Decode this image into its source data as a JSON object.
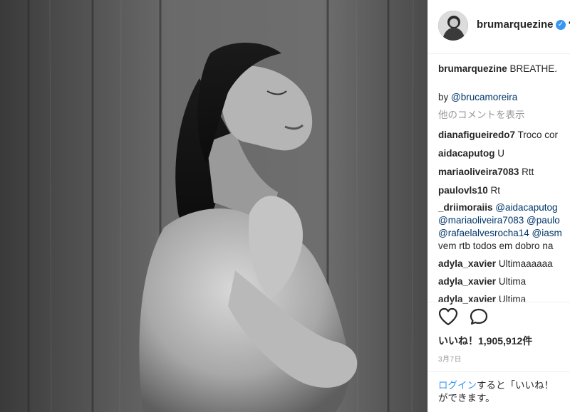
{
  "post": {
    "username": "brumarquezine",
    "more_glyph": "•",
    "caption_user": "brumarquezine",
    "caption_text": " BREATHE.",
    "credit_prefix": "by ",
    "credit_link": "@brucamoreira",
    "view_more": "他のコメントを表示"
  },
  "comments": [
    {
      "user": "dianafigueiredo7",
      "text": " Troco cor"
    },
    {
      "user": "aidacaputog",
      "text": " U"
    },
    {
      "user": "mariaoliveira7083",
      "text": " Rtt"
    },
    {
      "user": "paulovls10",
      "text": " Rt"
    },
    {
      "user": "_driimoraiis",
      "mention1": " @aidacaputog",
      "line2": "@mariaoliveira7083 @paulo",
      "line3": "@rafaelalvesrocha14 @iasm",
      "line4": "vem rtb todos em dobro na"
    },
    {
      "user": "adyla_xavier",
      "text": " Ultimaaaaaa"
    },
    {
      "user": "adyla_xavier",
      "text": " Ultima"
    },
    {
      "user": "adyla_xavier",
      "text": " Ultima"
    }
  ],
  "actions": {
    "likes": "いいね！1,905,912件",
    "date": "3月7日"
  },
  "login": {
    "link": "ログイン",
    "text_after": "すると「いいね！",
    "line2": "ができます。"
  },
  "icons": {
    "heart": "heart-outline-icon",
    "comment": "comment-bubble-icon",
    "verified": "verified-badge-icon"
  },
  "colors": {
    "link": "#003569",
    "login_link": "#3897f0",
    "muted": "#999999",
    "text": "#262626"
  }
}
